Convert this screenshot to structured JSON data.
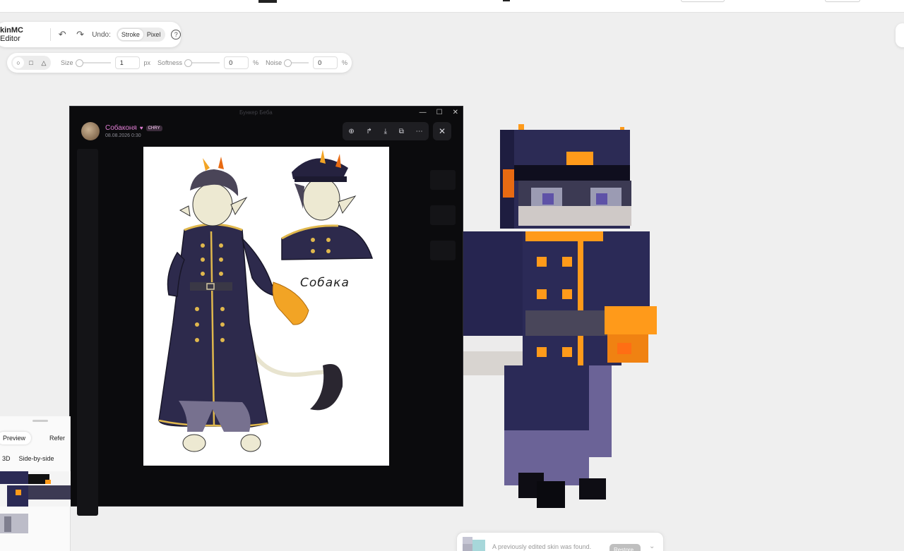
{
  "editor": {
    "brand_suffix": "kinMC",
    "brand_word": "Editor",
    "undo_label": "Undo:",
    "undo_modes": [
      "Stroke",
      "Pixel"
    ],
    "help_label": "?",
    "undo_icon": "undo-icon",
    "redo_icon": "redo-icon"
  },
  "brush": {
    "shapes": [
      "circle",
      "square",
      "triangle"
    ],
    "size_label": "Size",
    "size_value": "1",
    "size_unit": "px",
    "softness_label": "Softness",
    "softness_value": "0",
    "softness_unit": "%",
    "noise_label": "Noise",
    "noise_value": "0",
    "noise_unit": "%"
  },
  "viewer": {
    "window_title": "Бункер Беба",
    "author_name": "Собаконя",
    "author_badge": "CHRY",
    "post_date": "08.08.2026 0:30",
    "artwork_caption": "Собака",
    "tools": [
      "zoom-icon",
      "share-icon",
      "download-icon",
      "open-external-icon",
      "more-icon"
    ],
    "close_icon": "close-icon"
  },
  "bottom_panel": {
    "tabs": [
      "Preview",
      "Refer"
    ],
    "modes": [
      "3D",
      "Side-by-side"
    ]
  },
  "notice": {
    "message": "A previously edited skin was found.",
    "button": "Restore"
  },
  "colors": {
    "coat": "#2b2a52",
    "gold": "#ff9a1a",
    "skin": "#f1eee0",
    "pants": "#6b6397",
    "accent": "#e37fd6"
  }
}
